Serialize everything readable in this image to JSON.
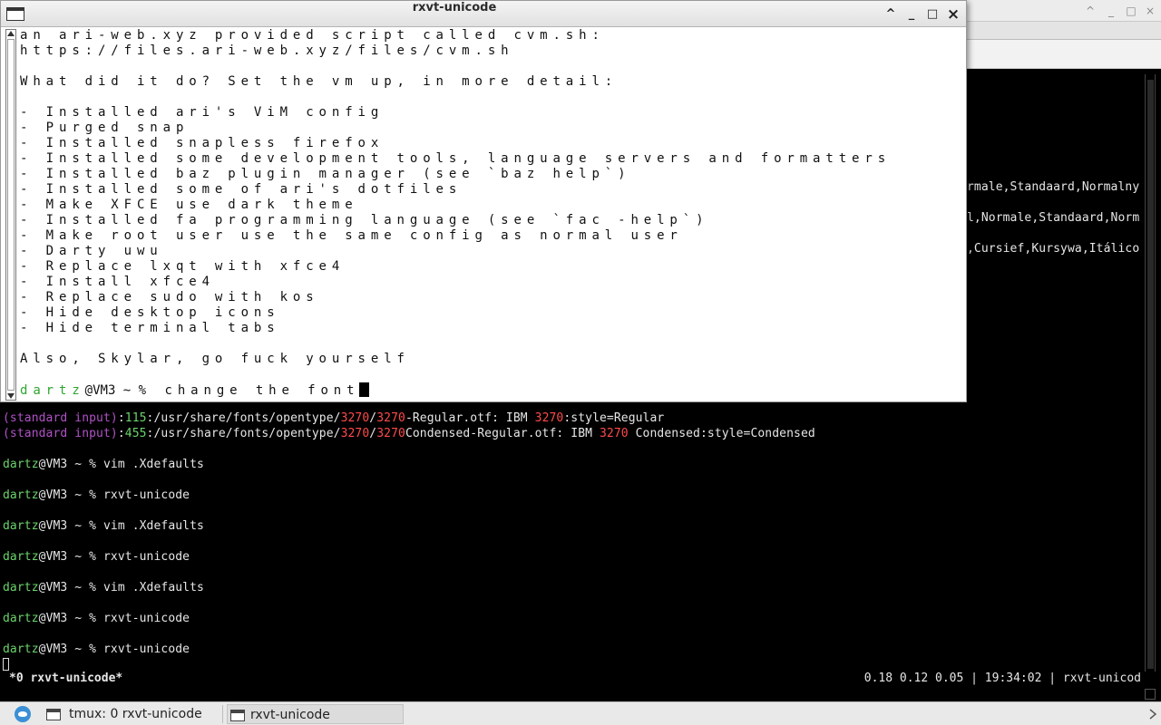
{
  "background_terminal": {
    "partial_lines": [
      {
        "text": "rmale,Standaard,Normalny"
      },
      {
        "text": "l,Normale,Standaard,Norm"
      },
      {
        "text": ",Cursief,Kursywa,Itálico"
      }
    ],
    "fc_list": [
      {
        "prefix": "(standard input)",
        "num": "115",
        "path_a": "/usr/share/fonts/opentype/",
        "dir": "3270",
        "path_b": "/",
        "file_a": "3270",
        "file_b": "-Regular.otf: IBM ",
        "name": "3270",
        "rest": ":style=Regular"
      },
      {
        "prefix": "(standard input)",
        "num": "455",
        "path_a": "/usr/share/fonts/opentype/",
        "dir": "3270",
        "path_b": "/",
        "file_a": "3270",
        "file_b": "Condensed-Regular.otf: IBM ",
        "name": "3270",
        "rest": " Condensed:style=Condensed"
      }
    ],
    "history": [
      {
        "user": "dartz",
        "host": "@VM3 ~ % ",
        "cmd": "vim .Xdefaults"
      },
      {
        "user": "dartz",
        "host": "@VM3 ~ % ",
        "cmd": "rxvt-unicode"
      },
      {
        "user": "dartz",
        "host": "@VM3 ~ % ",
        "cmd": "vim .Xdefaults"
      },
      {
        "user": "dartz",
        "host": "@VM3 ~ % ",
        "cmd": "rxvt-unicode"
      },
      {
        "user": "dartz",
        "host": "@VM3 ~ % ",
        "cmd": "vim .Xdefaults"
      },
      {
        "user": "dartz",
        "host": "@VM3 ~ % ",
        "cmd": "rxvt-unicode"
      },
      {
        "user": "dartz",
        "host": "@VM3 ~ % ",
        "cmd": "rxvt-unicode"
      }
    ],
    "status_left": "*0 rxvt-unicode*",
    "status_right": "0.18 0.12 0.05 | 19:34:02 | rxvt-unicod"
  },
  "window": {
    "title": "rxvt-unicode",
    "controls": {
      "shade": "^",
      "minimize": "_",
      "maximize": "□",
      "close": "×"
    }
  },
  "terminal_text": {
    "lines": [
      "an ari-web.xyz provided script called cvm.sh:",
      "https://files.ari-web.xyz/files/cvm.sh",
      "",
      "What did it do? Set the vm up, in more detail:",
      "",
      "- Installed ari's ViM config",
      "- Purged snap",
      "- Installed snapless firefox",
      "- Installed some development tools, language servers and formatters",
      "- Installed baz plugin manager (see `baz help`)",
      "- Installed some of ari's dotfiles",
      "- Make XFCE use dark theme",
      "- Installed fa programming language (see `fac -help`)",
      "- Make root user use the same config as normal user",
      "- Darty uwu",
      "- Replace lxqt with xfce4",
      "- Install xfce4",
      "- Replace sudo with kos",
      "- Hide desktop icons",
      "- Hide terminal tabs",
      "",
      "Also, Skylar, go fuck yourself",
      ""
    ],
    "prompt_user": "dartz",
    "prompt_host": "@VM3 ~ % ",
    "prompt_input": "change the font"
  },
  "taskbar": {
    "items": [
      {
        "label": "tmux: 0 rxvt-unicode",
        "icon": "terminal-icon"
      },
      {
        "label": "rxvt-unicode",
        "icon": "terminal-icon"
      }
    ]
  },
  "colors": {
    "prompt_user_fg": "#2ea52e",
    "prompt_user_bg": "#6bd46b",
    "grep_label": "#b152c8",
    "grep_match": "#ff4a4a"
  }
}
